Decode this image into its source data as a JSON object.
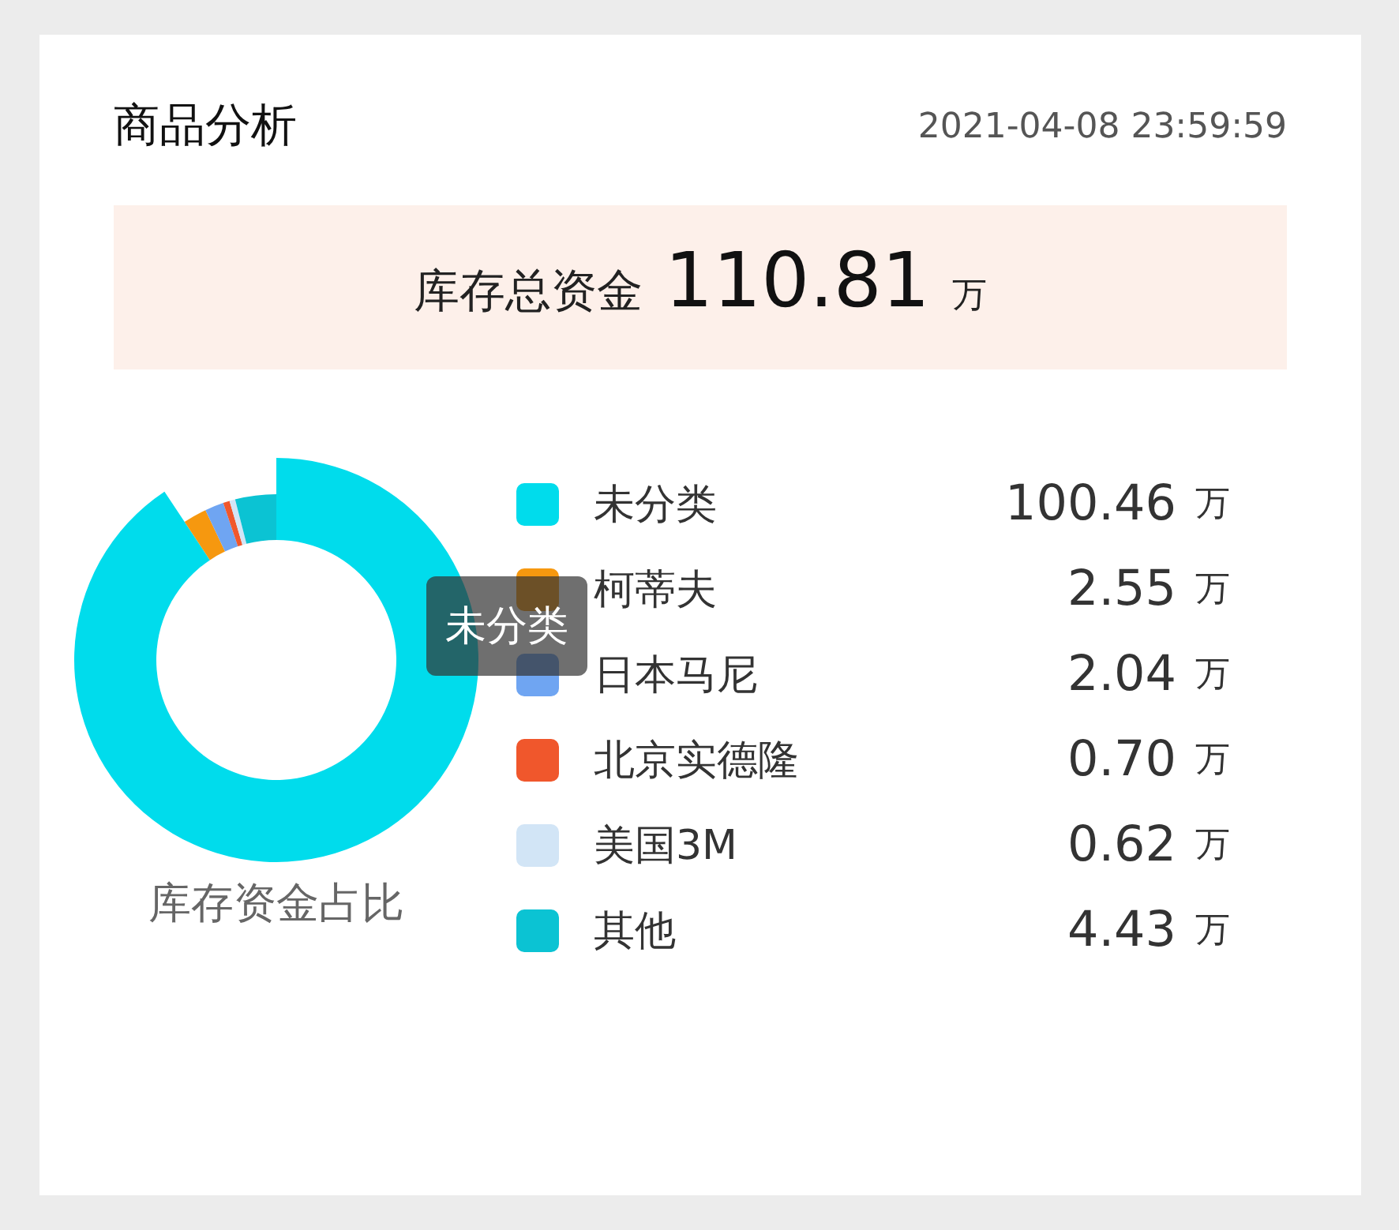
{
  "title": "商品分析",
  "timestamp": "2021-04-08 23:59:59",
  "total": {
    "label": "库存总资金",
    "value": "110.81",
    "unit": "万"
  },
  "chart": {
    "caption": "库存资金占比",
    "tooltip": "未分类",
    "slices": [
      {
        "emphasized": true
      },
      {
        "emphasized": false
      },
      {
        "emphasized": false
      },
      {
        "emphasized": false
      },
      {
        "emphasized": false
      },
      {
        "emphasized": false
      }
    ]
  },
  "legend": [
    {
      "name": "未分类",
      "value": "100.46",
      "unit": "万",
      "color": "#00dcec"
    },
    {
      "name": "柯蒂夫",
      "value": "2.55",
      "unit": "万",
      "color": "#f6980f"
    },
    {
      "name": "日本马尼",
      "value": "2.04",
      "unit": "万",
      "color": "#6fa5f2"
    },
    {
      "name": "北京实德隆",
      "value": "0.70",
      "unit": "万",
      "color": "#f0572c"
    },
    {
      "name": "美国3M",
      "value": "0.62",
      "unit": "万",
      "color": "#d2e5f6"
    },
    {
      "name": "其他",
      "value": "4.43",
      "unit": "万",
      "color": "#0bc3d3"
    }
  ]
}
